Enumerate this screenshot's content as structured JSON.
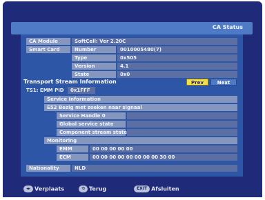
{
  "header": {
    "title": "CA Status"
  },
  "ca_module": {
    "label": "CA Module",
    "value": "SoftCell: Ver 2.20C"
  },
  "smart_card": {
    "label": "Smart Card",
    "rows": [
      {
        "key": "Number",
        "value": "0010005480(7)"
      },
      {
        "key": "Type",
        "value": "0x505"
      },
      {
        "key": "Version",
        "value": "4.1"
      },
      {
        "key": "State",
        "value": "0x0"
      }
    ]
  },
  "transport": {
    "title": "Transport Stream Information",
    "prev_label": "Prev",
    "next_label": "Next",
    "tsi_label": "TS1: EMM PID",
    "tsi_value": "0x1FFF",
    "service_info": "Service Information",
    "service_message": "E52 Bezig met zoeken naar signaal",
    "service_rows": [
      "Service Handle 0",
      "Global service state",
      "Component stream state"
    ],
    "monitoring": "Monitoring",
    "emm_label": "EMM",
    "emm_value": "00 00 00 00 00",
    "ecm_label": "ECM",
    "ecm_value": "00 00 00 00 00 00 00 00 30 00"
  },
  "nationality": {
    "label": "Nationality",
    "value": "NLD"
  },
  "footer": {
    "move_key": "◂▸",
    "move_label": "Verplaats",
    "back_key": "⟲",
    "back_label": "Terug",
    "exit_key": "EXIT",
    "exit_label": "Afsluiten"
  },
  "colors": {
    "background": "#1f2a78",
    "panel": "#2e56a6",
    "label": "#8596bf",
    "value": "#5b6fa5",
    "prev": "#f3e04a",
    "next": "#4f7bc6"
  }
}
